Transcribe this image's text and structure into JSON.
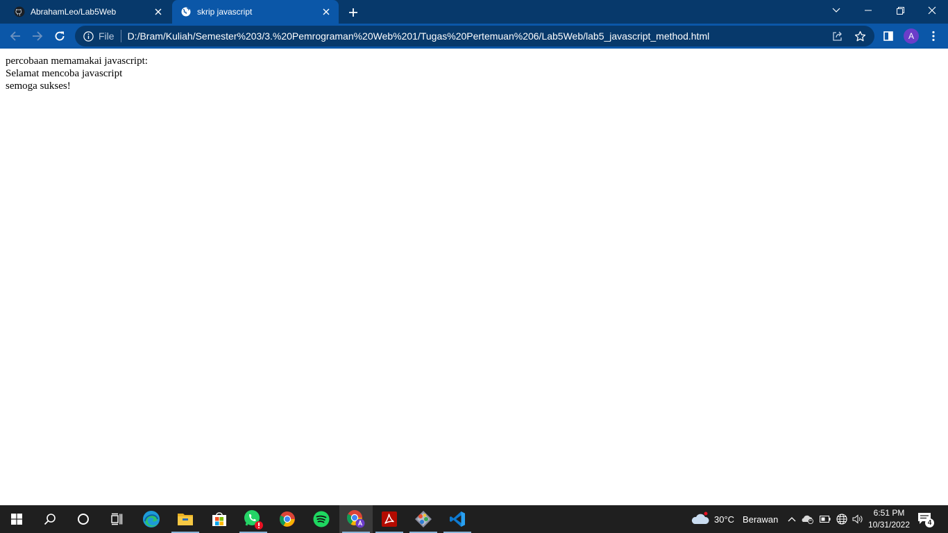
{
  "browser": {
    "tabs": [
      {
        "title": "AbrahamLeo/Lab5Web",
        "favicon": "github-icon",
        "active": false
      },
      {
        "title": "skrip javascript",
        "favicon": "globe-icon",
        "active": true
      }
    ],
    "new_tab_icon": "plus-icon",
    "window_controls": [
      "chevron-down-icon",
      "minimize-icon",
      "restore-icon",
      "close-icon"
    ],
    "address_bar": {
      "scheme_label": "File",
      "url": "D:/Bram/Kuliah/Semester%203/3.%20Pemrograman%20Web%201/Tugas%20Pertemuan%206/Lab5Web/lab5_javascript_method.html"
    },
    "profile_initial": "A",
    "colors": {
      "tab_strip": "#07396b",
      "toolbar": "#0b57a8",
      "omnibox": "#07396b",
      "avatar": "#6b3dc9"
    }
  },
  "page": {
    "lines": [
      "percobaan memamakai javascript:",
      "Selamat mencoba javascript",
      "semoga sukses!"
    ]
  },
  "taskbar": {
    "apps": [
      "windows-start-icon",
      "search-icon",
      "cortana-icon",
      "task-view-icon",
      "edge-icon",
      "file-explorer-icon",
      "microsoft-store-icon",
      "whatsapp-icon",
      "chrome-icon",
      "spotify-icon",
      "chrome-profile-icon",
      "acrobat-icon",
      "git-icon",
      "vscode-icon"
    ],
    "weather": {
      "temperature": "30°C",
      "condition": "Berawan"
    },
    "clock": {
      "time": "6:51 PM",
      "date": "10/31/2022"
    },
    "notification_count": "4"
  }
}
